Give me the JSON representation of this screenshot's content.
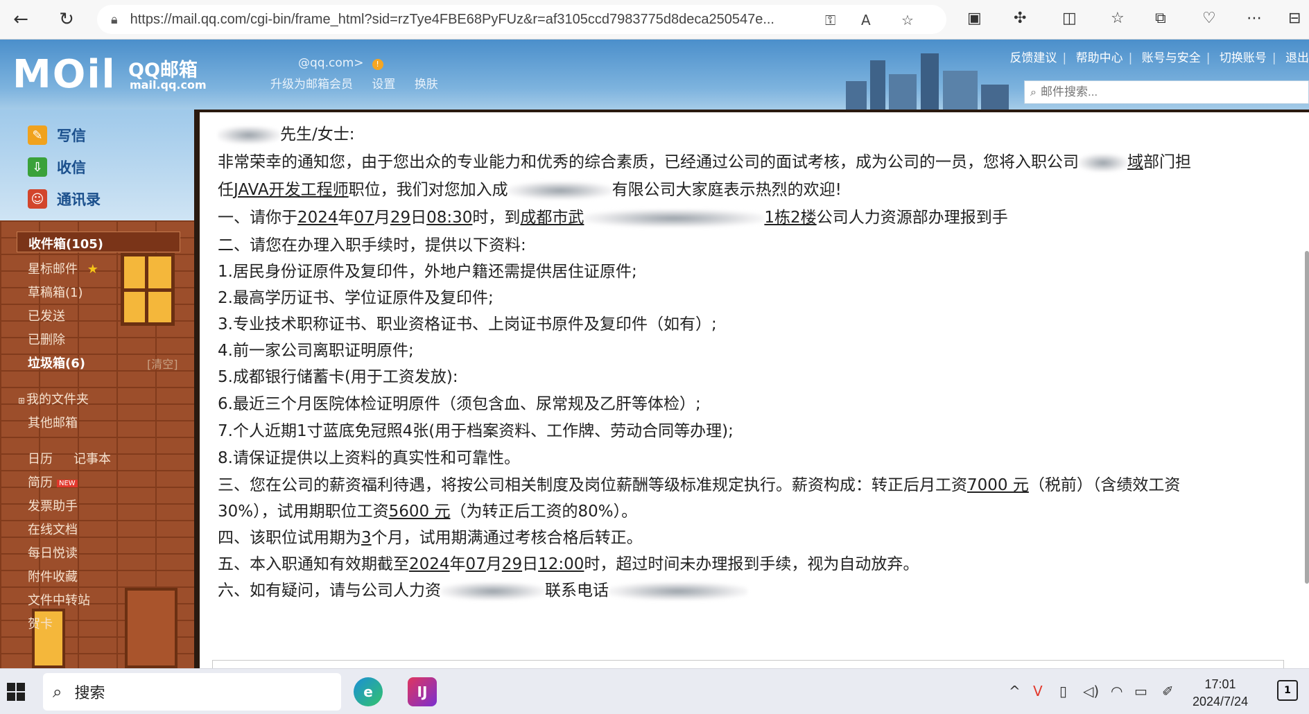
{
  "browser": {
    "url": "https://mail.qq.com/cgi-bin/frame_html?sid=rzTye4FBE68PyFUz&r=af3105ccd7983775d8deca250547e..."
  },
  "mail_header": {
    "logo_text": "MOil",
    "brand_cn": "QQ邮箱",
    "brand_domain": "mail.qq.com",
    "account": "@qq.com>",
    "links": [
      "升级为邮箱会员",
      "设置",
      "换肤"
    ],
    "top_links": [
      "反馈建议",
      "帮助中心",
      "账号与安全",
      "切换账号",
      "退出"
    ],
    "search_placeholder": "邮件搜索..."
  },
  "sidebar": {
    "actions": [
      {
        "label": "写信",
        "icon": "compose-icon",
        "color": "#f0a21e"
      },
      {
        "label": "收信",
        "icon": "inbox-download-icon",
        "color": "#3aa13a"
      },
      {
        "label": "通讯录",
        "icon": "contacts-icon",
        "color": "#d2452c"
      }
    ],
    "inbox": "收件箱(105)",
    "folders": [
      {
        "label": "星标邮件",
        "star": "★"
      },
      {
        "label": "草稿箱(1)"
      },
      {
        "label": "已发送"
      },
      {
        "label": "已删除"
      },
      {
        "label": "垃圾箱(6)",
        "bold": true
      }
    ],
    "clear": "[清空]",
    "my_folders": "我的文件夹",
    "other_mailbox": "其他邮箱",
    "calendar": "日历",
    "notes": "记事本",
    "resume": "简历",
    "resume_badge": "NEW",
    "tools": [
      "发票助手",
      "在线文档",
      "每日悦读",
      "附件收藏",
      "文件中转站",
      "贺卡"
    ]
  },
  "letter": {
    "salutation": "先生/女士:",
    "l1": "非常荣幸的通知您，由于您出众的专业能力和优秀的综合素质，已经通过公司的面试考核，成为公司的一员，您将入职公司",
    "l1_dept": "域",
    "l1_end": "部门担",
    "l2_prefix": "任",
    "l2_position": "JAVA开发工程师",
    "l2_mid": "职位，我们对您加入成",
    "l2_end": "有限公司大家庭表示热烈的欢迎!",
    "l3_prefix": "一、请你于",
    "date_year": "2024",
    "date_month": "07",
    "date_day": "29",
    "date_time": "08:30",
    "l3_mid": "时，到",
    "l3_location": "成都市武",
    "l3_floor": "1栋2楼",
    "l3_end": "公司人力资源部办理报到手",
    "l4": "二、请您在办理入职手续时，提供以下资料:",
    "items": [
      "1.居民身份证原件及复印件，外地户籍还需提供居住证原件;",
      "2.最高学历证书、学位证原件及复印件;",
      "3.专业技术职称证书、职业资格证书、上岗证书原件及复印件（如有）;",
      "4.前一家公司离职证明原件;",
      "5.成都银行储蓄卡(用于工资发放):",
      "6.最近三个月医院体检证明原件（须包含血、尿常规及乙肝等体检）;",
      "7.个人近期1寸蓝底免冠照4张(用于档案资料、工作牌、劳动合同等办理);",
      "8.请保证提供以上资料的真实性和可靠性。"
    ],
    "salary_prefix": "三、您在公司的薪资福利待遇，将按公司相关制度及岗位薪酬等级标准规定执行。薪资构成：转正后月工资",
    "salary_amount": "7000 元",
    "salary_suffix": "（税前）（含绩效工资",
    "salary_l2_prefix": "30%），试用期职位工资",
    "probation_amount": "5600 元",
    "salary_l2_suffix": "（为转正后工资的80%）。",
    "probation_prefix": "四、该职位试用期为",
    "probation_months": "3",
    "probation_suffix": "个月，试用期满通过考核合格后转正。",
    "valid_prefix": "五、本入职通知有效期截至",
    "valid_year": "2024",
    "valid_month": "07",
    "valid_day": "29",
    "valid_time": "12:00",
    "valid_suffix": "时，超过时间未办理报到手续，视为自动放弃。",
    "contact_prefix": "六、如有疑问，请与公司人力资",
    "contact_mid": "联系电话",
    "unit_year": "年",
    "unit_month": "月",
    "unit_day": "日"
  },
  "taskbar": {
    "search_label": "搜索",
    "time": "17:01",
    "date": "2024/7/24",
    "notification_count": "1"
  }
}
